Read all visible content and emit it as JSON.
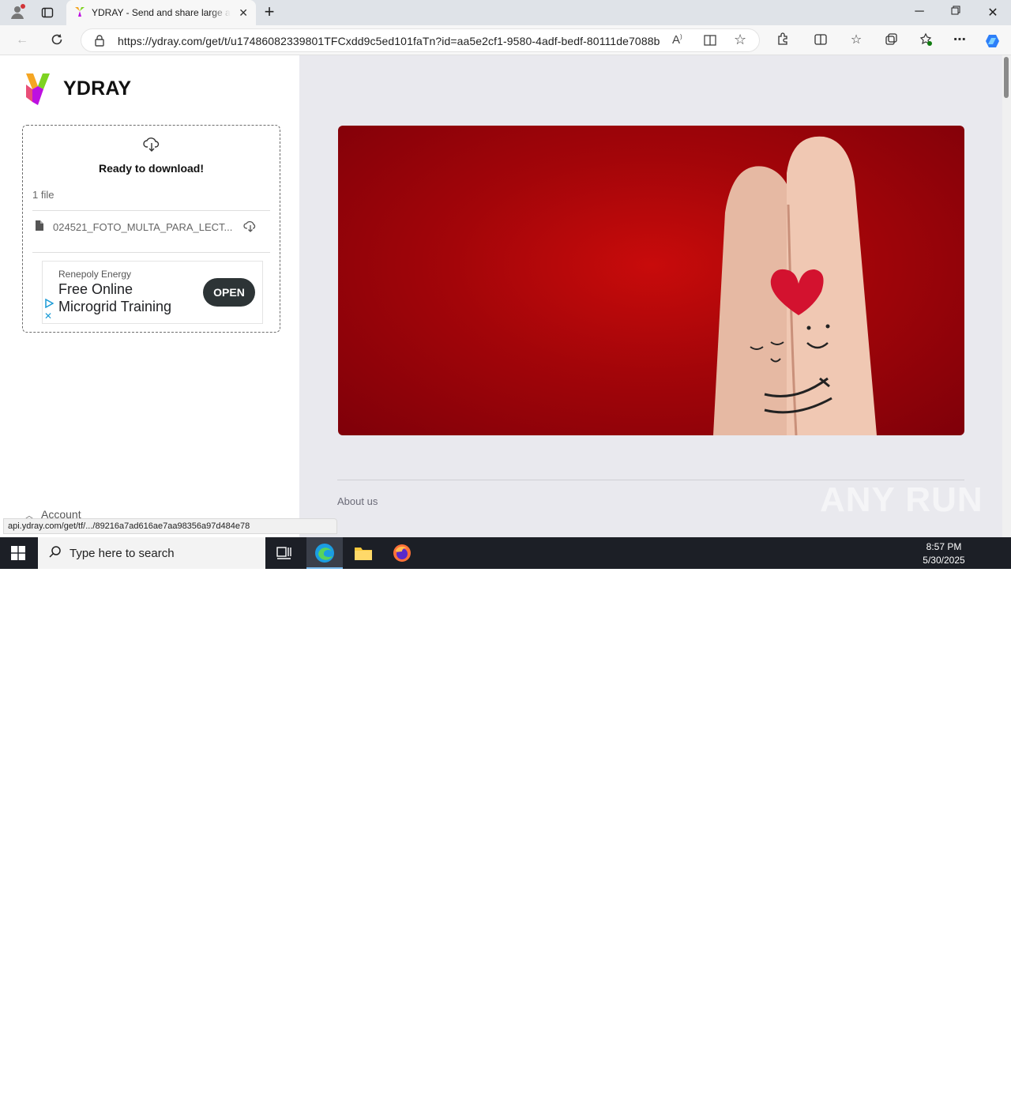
{
  "browser": {
    "tab_title": "YDRAY - Send and share large and",
    "url": "https://ydray.com/get/t/u17486082339801TFCxdd9c5ed101faTn?id=aa5e2cf1-9580-4adf-bedf-80111de7088b",
    "new_tab_label": "+",
    "status_url": "api.ydray.com/get/tf/.../89216a7ad616ae7aa98356a97d484e78"
  },
  "page": {
    "logo_text": "YDRAY",
    "ready_label": "Ready to download!",
    "file_count": "1 file",
    "file_name": "024521_FOTO_MULTA_PARA_LECT...",
    "account_label": "Account",
    "about_label": "About us"
  },
  "ad": {
    "sponsor": "Renepoly Energy",
    "headline": "Free Online Microgrid Training",
    "cta": "OPEN"
  },
  "watermark": "ANY RUN",
  "taskbar": {
    "search_placeholder": "Type here to search",
    "time": "8:57 PM",
    "date": "5/30/2025"
  },
  "colors": {
    "brand_dark": "#2d3436",
    "banner_red": "#b1050b",
    "right_bg": "#e9e9ee"
  }
}
